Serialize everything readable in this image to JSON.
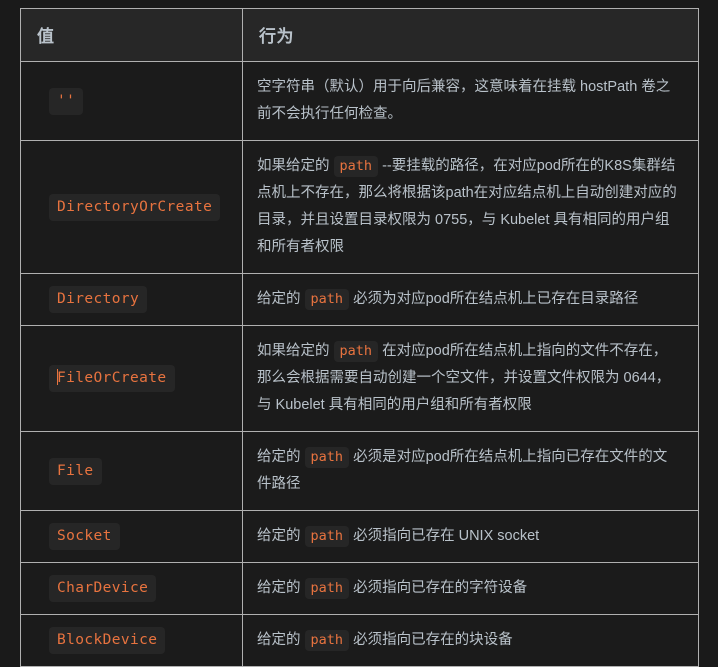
{
  "table": {
    "headers": {
      "value": "值",
      "behavior": "行为"
    },
    "rows": [
      {
        "value": "''",
        "value_is_empty_string": true,
        "behavior_parts": [
          {
            "type": "text",
            "text": "空字符串（默认）用于向后兼容，这意味着在挂载 hostPath 卷之前不会执行任何检查。"
          }
        ]
      },
      {
        "value": "DirectoryOrCreate",
        "behavior_parts": [
          {
            "type": "text",
            "text": "如果给定的 "
          },
          {
            "type": "code",
            "text": "path"
          },
          {
            "type": "text",
            "text": " --要挂载的路径，在对应pod所在的K8S集群结点机上不存在，那么将根据该path在对应结点机上自动创建对应的目录，并且设置目录权限为 0755，与 Kubelet 具有相同的用户组和所有者权限"
          }
        ]
      },
      {
        "value": "Directory",
        "behavior_parts": [
          {
            "type": "text",
            "text": "给定的 "
          },
          {
            "type": "code",
            "text": "path"
          },
          {
            "type": "text",
            "text": " 必须为对应pod所在结点机上已存在目录路径"
          }
        ]
      },
      {
        "value": "FileOrCreate",
        "has_caret": true,
        "behavior_parts": [
          {
            "type": "text",
            "text": "如果给定的 "
          },
          {
            "type": "code",
            "text": "path"
          },
          {
            "type": "text",
            "text": " 在对应pod所在结点机上指向的文件不存在，那么会根据需要自动创建一个空文件，并设置文件权限为 0644，与 Kubelet 具有相同的用户组和所有者权限"
          }
        ]
      },
      {
        "value": "File",
        "behavior_parts": [
          {
            "type": "text",
            "text": "给定的 "
          },
          {
            "type": "code",
            "text": "path"
          },
          {
            "type": "text",
            "text": " 必须是对应pod所在结点机上指向已存在文件的文件路径"
          }
        ]
      },
      {
        "value": "Socket",
        "behavior_parts": [
          {
            "type": "text",
            "text": "给定的 "
          },
          {
            "type": "code",
            "text": "path"
          },
          {
            "type": "text",
            "text": " 必须指向已存在 UNIX socket"
          }
        ]
      },
      {
        "value": "CharDevice",
        "behavior_parts": [
          {
            "type": "text",
            "text": "给定的 "
          },
          {
            "type": "code",
            "text": "path"
          },
          {
            "type": "text",
            "text": " 必须指向已存在的字符设备"
          }
        ]
      },
      {
        "value": "BlockDevice",
        "behavior_parts": [
          {
            "type": "text",
            "text": "给定的 "
          },
          {
            "type": "code",
            "text": "path"
          },
          {
            "type": "text",
            "text": " 必须指向已存在的块设备"
          }
        ]
      }
    ]
  },
  "colors": {
    "page_background": "#1a1a1a",
    "cell_background": "#1b1b1b",
    "header_background": "#272727",
    "border": "#b0b0b0",
    "text": "#b9c2ca",
    "code_accent": "#e8733f",
    "code_chip_background": "#262626"
  }
}
